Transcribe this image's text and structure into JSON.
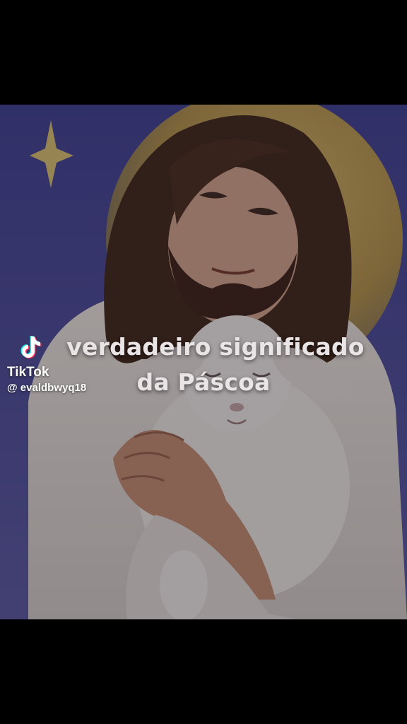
{
  "video": {
    "caption_line1": "verdadeiro significado",
    "caption_line2": "da Páscoa",
    "scene_icon": "jesus-holding-lamb-illustration"
  },
  "watermark": {
    "brand": "TikTok",
    "username": "@ evaldbwyq18",
    "logo_icon": "tiktok-logo-icon"
  },
  "colors": {
    "letterbox": "#000000",
    "night_sky": "#4a4aa0",
    "halo": "#c9a85a",
    "caption_text": "#e9e4e6"
  }
}
